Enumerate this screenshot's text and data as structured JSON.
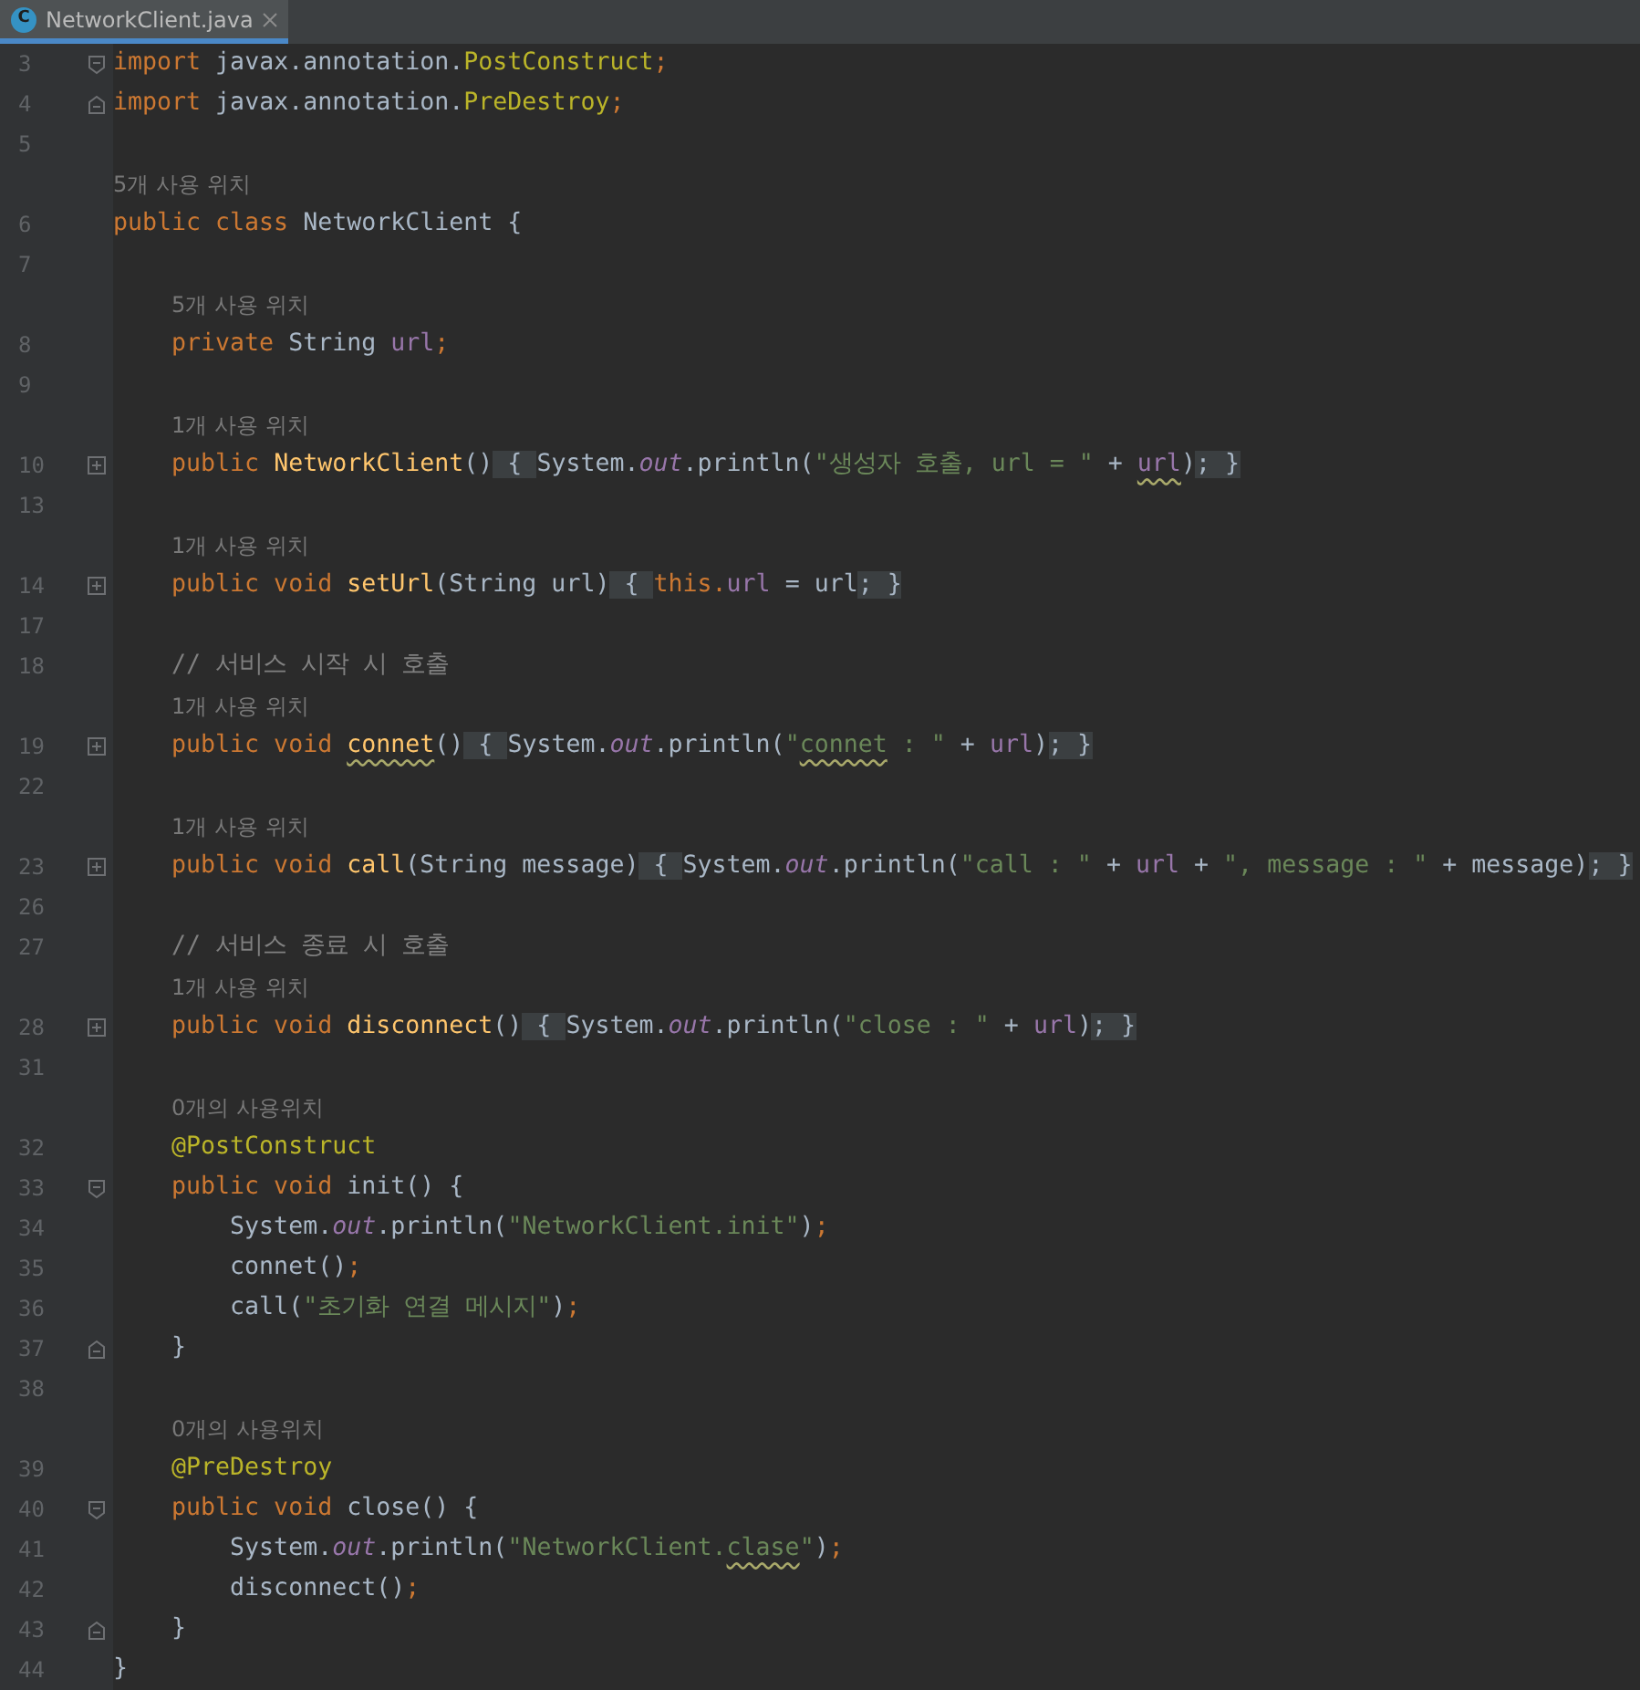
{
  "tab": {
    "icon_letter": "C",
    "title": "NetworkClient.java",
    "selected": true
  },
  "lines": [
    {
      "kind": "code",
      "number": "3",
      "fold": {
        "kind": "start"
      },
      "tokens": [
        {
          "kind": "kw",
          "text": "import"
        },
        {
          "kind": "plain",
          "text": " javax.annotation."
        },
        {
          "kind": "ann",
          "text": "PostConstruct"
        },
        {
          "kind": "kw",
          "text": ";"
        }
      ]
    },
    {
      "kind": "code",
      "number": "4",
      "fold": {
        "kind": "end"
      },
      "tokens": [
        {
          "kind": "kw",
          "text": "import"
        },
        {
          "kind": "plain",
          "text": " javax.annotation."
        },
        {
          "kind": "ann",
          "text": "PreDestroy"
        },
        {
          "kind": "kw",
          "text": ";"
        }
      ]
    },
    {
      "kind": "code",
      "number": "5"
    },
    {
      "kind": "hint",
      "text": "5개 사용 위치"
    },
    {
      "kind": "code",
      "number": "6",
      "tokens": [
        {
          "kind": "kw",
          "text": "public class"
        },
        {
          "kind": "plain",
          "text": " NetworkClient {"
        }
      ]
    },
    {
      "kind": "code",
      "number": "7"
    },
    {
      "kind": "member_hint",
      "text": "5개 사용 위치"
    },
    {
      "kind": "code",
      "number": "8",
      "tokens": [
        {
          "kind": "kw",
          "text": "    private"
        },
        {
          "kind": "plain",
          "text": " String "
        },
        {
          "kind": "field",
          "text": "url"
        },
        {
          "kind": "kw",
          "text": ";"
        }
      ]
    },
    {
      "kind": "code",
      "number": "9"
    },
    {
      "kind": "member_hint",
      "text": "1개 사용 위치"
    },
    {
      "kind": "code",
      "number": "10",
      "fold": {
        "kind": "collapsed"
      },
      "tokens": [
        {
          "kind": "kw",
          "text": "    public "
        },
        {
          "kind": "method",
          "text": "NetworkClient"
        },
        {
          "kind": "plain",
          "text": "()"
        },
        {
          "kind": "folded",
          "text": " { "
        },
        {
          "kind": "plain",
          "text": "System."
        },
        {
          "kind": "static",
          "text": "out"
        },
        {
          "kind": "plain",
          "text": ".println("
        },
        {
          "kind": "str",
          "text": "\"생성자 호출, url = \""
        },
        {
          "kind": "plain",
          "text": " + "
        },
        {
          "kind": "field",
          "text": "url",
          "typo": true
        },
        {
          "kind": "plain",
          "text": ")"
        },
        {
          "kind": "folded",
          "text": "; }"
        }
      ]
    },
    {
      "kind": "code",
      "number": "13"
    },
    {
      "kind": "member_hint",
      "text": "1개 사용 위치"
    },
    {
      "kind": "code",
      "number": "14",
      "fold": {
        "kind": "collapsed"
      },
      "tokens": [
        {
          "kind": "kw",
          "text": "    public void "
        },
        {
          "kind": "method",
          "text": "setUrl"
        },
        {
          "kind": "plain",
          "text": "(String url)"
        },
        {
          "kind": "folded",
          "text": " { "
        },
        {
          "kind": "kw",
          "text": "this."
        },
        {
          "kind": "field",
          "text": "url"
        },
        {
          "kind": "plain",
          "text": " = url"
        },
        {
          "kind": "folded",
          "text": "; }"
        }
      ]
    },
    {
      "kind": "code",
      "number": "17"
    },
    {
      "kind": "code",
      "number": "18",
      "tokens": [
        {
          "kind": "comment",
          "text": "    // 서비스 시작 시 호출"
        }
      ]
    },
    {
      "kind": "member_hint",
      "text": "1개 사용 위치"
    },
    {
      "kind": "code",
      "number": "19",
      "fold": {
        "kind": "collapsed"
      },
      "tokens": [
        {
          "kind": "kw",
          "text": "    public void "
        },
        {
          "kind": "method",
          "text": "connet",
          "typo": true
        },
        {
          "kind": "plain",
          "text": "()"
        },
        {
          "kind": "folded",
          "text": " { "
        },
        {
          "kind": "plain",
          "text": "System."
        },
        {
          "kind": "static",
          "text": "out"
        },
        {
          "kind": "plain",
          "text": ".println("
        },
        {
          "kind": "str",
          "text": "\""
        },
        {
          "kind": "str",
          "text": "connet",
          "typo": true
        },
        {
          "kind": "str",
          "text": " : \""
        },
        {
          "kind": "plain",
          "text": " + "
        },
        {
          "kind": "field",
          "text": "url"
        },
        {
          "kind": "plain",
          "text": ")"
        },
        {
          "kind": "folded",
          "text": "; }"
        }
      ]
    },
    {
      "kind": "code",
      "number": "22"
    },
    {
      "kind": "member_hint",
      "text": "1개 사용 위치"
    },
    {
      "kind": "code",
      "number": "23",
      "fold": {
        "kind": "collapsed"
      },
      "tokens": [
        {
          "kind": "kw",
          "text": "    public void "
        },
        {
          "kind": "method",
          "text": "call"
        },
        {
          "kind": "plain",
          "text": "(String message)"
        },
        {
          "kind": "folded",
          "text": " { "
        },
        {
          "kind": "plain",
          "text": "System."
        },
        {
          "kind": "static",
          "text": "out"
        },
        {
          "kind": "plain",
          "text": ".println("
        },
        {
          "kind": "str",
          "text": "\"call : \""
        },
        {
          "kind": "plain",
          "text": " + "
        },
        {
          "kind": "field",
          "text": "url"
        },
        {
          "kind": "plain",
          "text": " + "
        },
        {
          "kind": "str",
          "text": "\", message : \""
        },
        {
          "kind": "plain",
          "text": " + message)"
        },
        {
          "kind": "folded",
          "text": "; }"
        }
      ]
    },
    {
      "kind": "code",
      "number": "26"
    },
    {
      "kind": "code",
      "number": "27",
      "tokens": [
        {
          "kind": "comment",
          "text": "    // 서비스 종료 시 호출"
        }
      ]
    },
    {
      "kind": "member_hint",
      "text": "1개 사용 위치"
    },
    {
      "kind": "code",
      "number": "28",
      "fold": {
        "kind": "collapsed"
      },
      "tokens": [
        {
          "kind": "kw",
          "text": "    public void "
        },
        {
          "kind": "method",
          "text": "disconnect"
        },
        {
          "kind": "plain",
          "text": "()"
        },
        {
          "kind": "folded",
          "text": " { "
        },
        {
          "kind": "plain",
          "text": "System."
        },
        {
          "kind": "static",
          "text": "out"
        },
        {
          "kind": "plain",
          "text": ".println("
        },
        {
          "kind": "str",
          "text": "\"close : \""
        },
        {
          "kind": "plain",
          "text": " + "
        },
        {
          "kind": "field",
          "text": "url"
        },
        {
          "kind": "plain",
          "text": ")"
        },
        {
          "kind": "folded",
          "text": "; }"
        }
      ]
    },
    {
      "kind": "code",
      "number": "31"
    },
    {
      "kind": "member_hint",
      "text": "0개의 사용위치"
    },
    {
      "kind": "code",
      "number": "32",
      "tokens": [
        {
          "kind": "ann",
          "text": "    @PostConstruct"
        }
      ]
    },
    {
      "kind": "code",
      "number": "33",
      "fold": {
        "kind": "start"
      },
      "tokens": [
        {
          "kind": "kw",
          "text": "    public void"
        },
        {
          "kind": "plain",
          "text": " init() {"
        }
      ]
    },
    {
      "kind": "code",
      "number": "34",
      "tokens": [
        {
          "kind": "plain",
          "text": "        System."
        },
        {
          "kind": "static",
          "text": "out"
        },
        {
          "kind": "plain",
          "text": ".println("
        },
        {
          "kind": "str",
          "text": "\"NetworkClient.init\""
        },
        {
          "kind": "plain",
          "text": ")"
        },
        {
          "kind": "kw",
          "text": ";"
        }
      ]
    },
    {
      "kind": "code",
      "number": "35",
      "tokens": [
        {
          "kind": "plain",
          "text": "        connet()"
        },
        {
          "kind": "kw",
          "text": ";"
        }
      ]
    },
    {
      "kind": "code",
      "number": "36",
      "tokens": [
        {
          "kind": "plain",
          "text": "        call("
        },
        {
          "kind": "str",
          "text": "\"초기화 연결 메시지\""
        },
        {
          "kind": "plain",
          "text": ")"
        },
        {
          "kind": "kw",
          "text": ";"
        }
      ]
    },
    {
      "kind": "code",
      "number": "37",
      "fold": {
        "kind": "end"
      },
      "tokens": [
        {
          "kind": "plain",
          "text": "    }"
        }
      ]
    },
    {
      "kind": "code",
      "number": "38"
    },
    {
      "kind": "member_hint",
      "text": "0개의 사용위치"
    },
    {
      "kind": "code",
      "number": "39",
      "tokens": [
        {
          "kind": "ann",
          "text": "    @PreDestroy"
        }
      ]
    },
    {
      "kind": "code",
      "number": "40",
      "fold": {
        "kind": "start"
      },
      "tokens": [
        {
          "kind": "kw",
          "text": "    public void"
        },
        {
          "kind": "plain",
          "text": " close() {"
        }
      ]
    },
    {
      "kind": "code",
      "number": "41",
      "tokens": [
        {
          "kind": "plain",
          "text": "        System."
        },
        {
          "kind": "static",
          "text": "out"
        },
        {
          "kind": "plain",
          "text": ".println("
        },
        {
          "kind": "str",
          "text": "\"NetworkClient."
        },
        {
          "kind": "str",
          "text": "clase",
          "typo": true
        },
        {
          "kind": "str",
          "text": "\""
        },
        {
          "kind": "plain",
          "text": ")"
        },
        {
          "kind": "kw",
          "text": ";"
        }
      ]
    },
    {
      "kind": "code",
      "number": "42",
      "tokens": [
        {
          "kind": "plain",
          "text": "        disconnect()"
        },
        {
          "kind": "kw",
          "text": ";"
        }
      ]
    },
    {
      "kind": "code",
      "number": "43",
      "fold": {
        "kind": "end"
      },
      "tokens": [
        {
          "kind": "plain",
          "text": "    }"
        }
      ]
    },
    {
      "kind": "code",
      "number": "44",
      "tokens": [
        {
          "kind": "plain",
          "text": "}"
        }
      ]
    }
  ]
}
